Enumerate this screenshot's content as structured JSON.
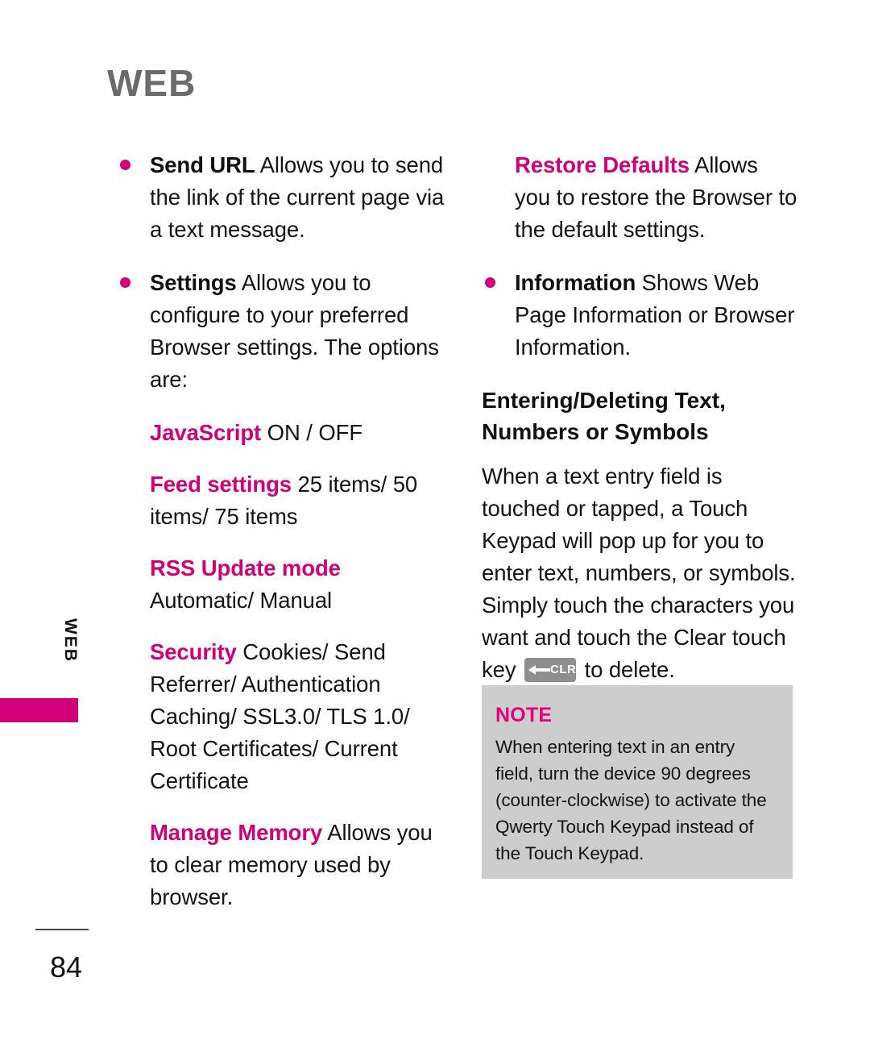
{
  "chapter": {
    "title": "WEB",
    "side_tab_label": "WEB",
    "accent_color": "#d1007a",
    "title_color": "#6b6b6b"
  },
  "left_column": {
    "items": [
      {
        "bullet": true,
        "term": "Send URL",
        "text": " Allows you to send the link of the current page via a text message."
      },
      {
        "bullet": true,
        "term": "Settings",
        "text": " Allows you to configure to your preferred Browser settings. The options are:"
      }
    ],
    "options": [
      {
        "term": "JavaScript",
        "values": " ON / OFF"
      },
      {
        "term": "Feed settings",
        "values": "  25 items/ 50 items/ 75 items"
      },
      {
        "term": "RSS Update mode",
        "values": " Automatic/ Manual",
        "break_after_term": true
      },
      {
        "term": "Security",
        "values": "  Cookies/ Send Referrer/ Authentication Caching/ SSL3.0/ TLS 1.0/ Root Certificates/ Current Certificate"
      }
    ],
    "manage_memory": {
      "term": "Manage Memory",
      "text": " Allows you to clear memory used by browser."
    }
  },
  "right_column": {
    "restore_defaults": {
      "term": "Restore Defaults",
      "text": " Allows you to restore the Browser to the default settings."
    },
    "information": {
      "term": "Information",
      "text": " Shows Web Page Information or Browser Information."
    },
    "section_heading": "Entering/Deleting Text, Numbers or Symbols",
    "body_before_key": "When a text entry field is touched or tapped, a Touch Keypad will pop up for you to enter text, numbers, or symbols. Simply touch the characters you want and touch the Clear touch key ",
    "body_after_key": " to delete.",
    "clear_key_label": "CLR"
  },
  "note": {
    "title": "NOTE",
    "body": "When entering text in an entry field, turn the device 90 degrees (counter-clockwise) to activate the Qwerty Touch Keypad instead of the Touch Keypad.",
    "background_color": "#cdcdcd",
    "title_color": "#e5007d"
  },
  "footer": {
    "page_number": "84"
  }
}
